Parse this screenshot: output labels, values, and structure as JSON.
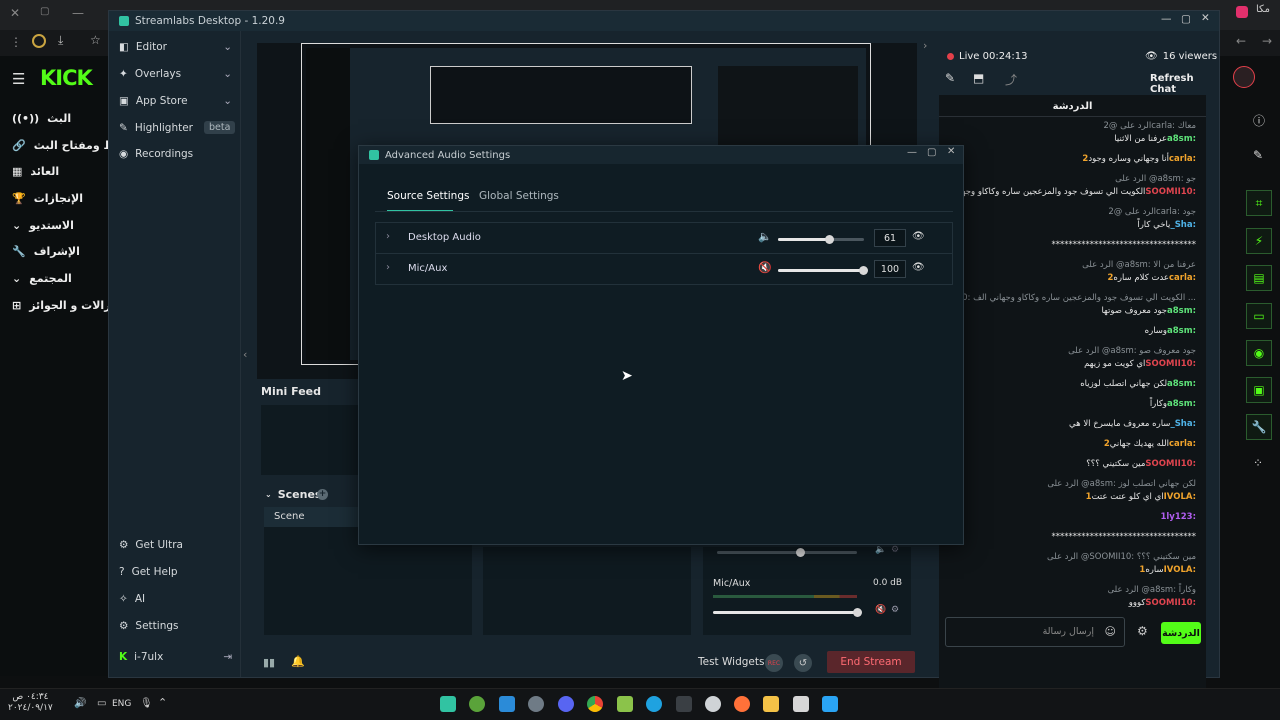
{
  "app": {
    "title": "Streamlabs Desktop - 1.20.9"
  },
  "kick": {
    "logo": "KICK",
    "nav": [
      "البث",
      "رابط ومفتاح البث",
      "العائد",
      "الإنجازات",
      "الاستديو",
      "الإشراف",
      "المجتمع",
      "الانزالات و الجوائز"
    ]
  },
  "sl_nav": {
    "editor": "Editor",
    "overlays": "Overlays",
    "app_store": "App Store",
    "highlighter": "Highlighter",
    "beta": "beta",
    "recordings": "Recordings",
    "get_ultra": "Get Ultra",
    "get_help": "Get Help",
    "ai": "AI",
    "settings": "Settings",
    "user": "i-7ulx"
  },
  "panels": {
    "mini_feed": "Mini Feed",
    "scenes": "Scenes",
    "scene_col": "Scene",
    "mic_aux": "Mic/Aux",
    "mic_db": "0.0 dB",
    "test_widgets": "Test Widgets",
    "rec": "REC",
    "end_stream": "End Stream"
  },
  "live": {
    "status": "Live 00:24:13",
    "viewers": "16 viewers",
    "refresh_chat": "Refresh Chat",
    "chat_title": "الدردشة"
  },
  "chat": [
    {
      "reply": "الرد على @2carla: معاك",
      "user": "a8sm",
      "msg": "عرفنا من الاثنيا",
      "color": "#5ee37a"
    },
    {
      "reply": "",
      "user": "2carla",
      "msg": "أنا وجهاني وساره وجود",
      "color": "#f1a42c"
    },
    {
      "reply": "الرد على @a8sm: جو",
      "user": "SOOMII10",
      "msg": "الكويت الي تسوف جود والمزعجين ساره وكاكاو وجهاني الف",
      "color": "#e0454f"
    },
    {
      "reply": "الرد على @2carla: جود",
      "user": "_Sha",
      "msg": "ياخي كاراً",
      "color": "#4fb3e8"
    },
    {
      "reply": "",
      "user": "",
      "msg": "**********************************",
      "color": "#e6e6e6"
    },
    {
      "reply": "الرد على @a8sm: عرفنا من الا",
      "user": "2carla",
      "msg": "عدت كلام ساره",
      "color": "#f1a42c"
    },
    {
      "reply": "الرد على @SOOMII10: الكويت الي تسوف جود والمزعجين ساره وكاكاو وجهاني الف ...",
      "user": "a8sm",
      "msg": "جود معروف صوتها",
      "color": "#5ee37a"
    },
    {
      "reply": "",
      "user": "a8sm",
      "msg": "وساره",
      "color": "#5ee37a"
    },
    {
      "reply": "الرد على @a8sm: جود معروف صو",
      "user": "SOOMII10",
      "msg": "اي كويت مو زيهم",
      "color": "#e0454f"
    },
    {
      "reply": "",
      "user": "a8sm",
      "msg": "لكن جهاني اتصلب لوزياه",
      "color": "#5ee37a"
    },
    {
      "reply": "",
      "user": "a8sm",
      "msg": "وكاراً",
      "color": "#5ee37a"
    },
    {
      "reply": "",
      "user": "_Sha",
      "msg": "ساره معروف مايسرخ الا هي",
      "color": "#4fb3e8"
    },
    {
      "reply": "",
      "user": "2carla",
      "msg": "الله يهديك جهاني",
      "color": "#f1a42c"
    },
    {
      "reply": "",
      "user": "SOOMII10",
      "msg": "مين سكتيني ؟؟؟",
      "color": "#e0454f"
    },
    {
      "reply": "الرد على @a8sm: لكن جهاني اتصلب لوز",
      "user": "1IVOLA",
      "msg": "اي اي كلو عتت عتت",
      "color": "#f1a42c"
    },
    {
      "reply": "",
      "user": "1ly123",
      "msg": "",
      "color": "#b15ef0"
    },
    {
      "reply": "",
      "user": "",
      "msg": "**********************************",
      "color": "#e6e6e6"
    },
    {
      "reply": "الرد على @SOOMII10: مين سكتيني ؟؟؟",
      "user": "1IVOLA",
      "msg": "ساره",
      "color": "#f1a42c"
    },
    {
      "reply": "الرد على @a8sm: وكاراً",
      "user": "SOOMII10",
      "msg": "كووو",
      "color": "#e0454f"
    }
  ],
  "chat_input": {
    "placeholder": "إرسال رسالة",
    "send": "الدردشة"
  },
  "modal": {
    "title": "Advanced Audio Settings",
    "tabs": [
      "Source Settings",
      "Global Settings"
    ],
    "sources": [
      {
        "name": "Desktop Audio",
        "volume": 61,
        "muted": false
      },
      {
        "name": "Mic/Aux",
        "volume": 100,
        "muted": true
      }
    ]
  },
  "taskbar": {
    "time": "٠٤:٣٤ ص",
    "date": "٢٠٢٤/٠٩/١٧",
    "lang": "ENG"
  },
  "colors": {
    "kick_green": "#53fc18",
    "sl_teal": "#31c3a2",
    "end_stream": "#e3404a"
  }
}
